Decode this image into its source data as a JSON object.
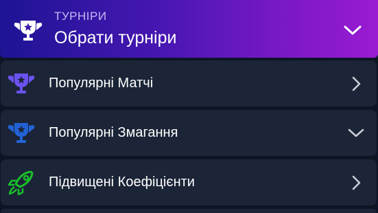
{
  "header": {
    "kicker": "ТУРНІРИ",
    "title": "Обрати турніри",
    "icon": "trophy-icon",
    "chevron": "chevron-down-icon",
    "gradient": [
      "#1d1494",
      "#9a1bd2"
    ]
  },
  "items": [
    {
      "label": "Популярні Матчі",
      "icon": "trophy-star-icon",
      "icon_color": "#6b52f0",
      "chevron": "chevron-right-icon"
    },
    {
      "label": "Популярні Змагання",
      "icon": "trophy-star-icon",
      "icon_color": "#2262d6",
      "chevron": "chevron-down-icon"
    },
    {
      "label": "Підвищені Коефіцієнти",
      "icon": "rocket-icon",
      "icon_color": "#19c12a",
      "chevron": "chevron-right-icon"
    }
  ],
  "colors": {
    "background": "#0d1525",
    "row": "#1b2537",
    "chevron": "#c8ccd4"
  }
}
